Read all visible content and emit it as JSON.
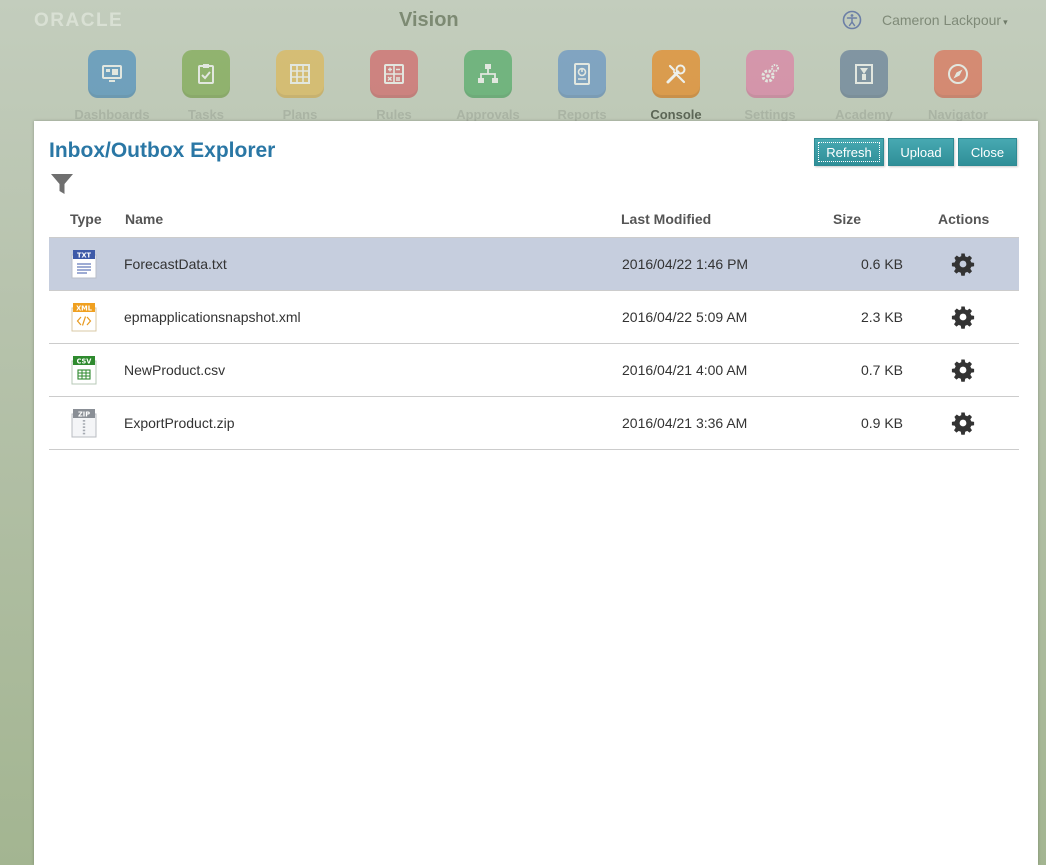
{
  "header": {
    "logo_text": "ORACLE",
    "app_title": "Vision",
    "user_name": "Cameron Lackpour",
    "user_caret": "▾"
  },
  "nav": [
    {
      "label": "Dashboards",
      "icon": "dashboards-icon",
      "color": "#2f7fbf"
    },
    {
      "label": "Tasks",
      "icon": "tasks-icon",
      "color": "#6aa032"
    },
    {
      "label": "Plans",
      "icon": "plans-icon",
      "color": "#e6b33d"
    },
    {
      "label": "Rules",
      "icon": "rules-icon",
      "color": "#d84a52"
    },
    {
      "label": "Approvals",
      "icon": "approvals-icon",
      "color": "#33a350"
    },
    {
      "label": "Reports",
      "icon": "reports-icon",
      "color": "#4d86c7"
    },
    {
      "label": "Console",
      "icon": "console-icon",
      "color": "#e58a25",
      "active": true
    },
    {
      "label": "Settings",
      "icon": "settings-icon",
      "color": "#e56b9f"
    },
    {
      "label": "Academy",
      "icon": "academy-icon",
      "color": "#4d6a8f"
    },
    {
      "label": "Navigator",
      "icon": "navigator-icon",
      "color": "#e5573a"
    }
  ],
  "panel": {
    "title": "Inbox/Outbox Explorer",
    "buttons": {
      "refresh": "Refresh",
      "upload": "Upload",
      "close": "Close"
    }
  },
  "table": {
    "columns": {
      "type": "Type",
      "name": "Name",
      "modified": "Last Modified",
      "size": "Size",
      "actions": "Actions"
    },
    "rows": [
      {
        "type": "TXT",
        "name": "ForecastData.txt",
        "modified": "2016/04/22 1:46 PM",
        "size": "0.6 KB",
        "selected": true
      },
      {
        "type": "XML",
        "name": "epmapplicationsnapshot.xml",
        "modified": "2016/04/22 5:09 AM",
        "size": "2.3 KB"
      },
      {
        "type": "CSV",
        "name": "NewProduct.csv",
        "modified": "2016/04/21 4:00 AM",
        "size": "0.7 KB"
      },
      {
        "type": "ZIP",
        "name": "ExportProduct.zip",
        "modified": "2016/04/21 3:36 AM",
        "size": "0.9 KB"
      }
    ]
  },
  "colors": {
    "accent": "#2a77a5",
    "button": "#3a9ea7",
    "selected_row": "#c6cede",
    "txt_badge": "#3e5aa8",
    "xml_badge": "#f0a020",
    "csv_badge": "#2e8a2e",
    "zip_badge": "#8a8f96"
  }
}
